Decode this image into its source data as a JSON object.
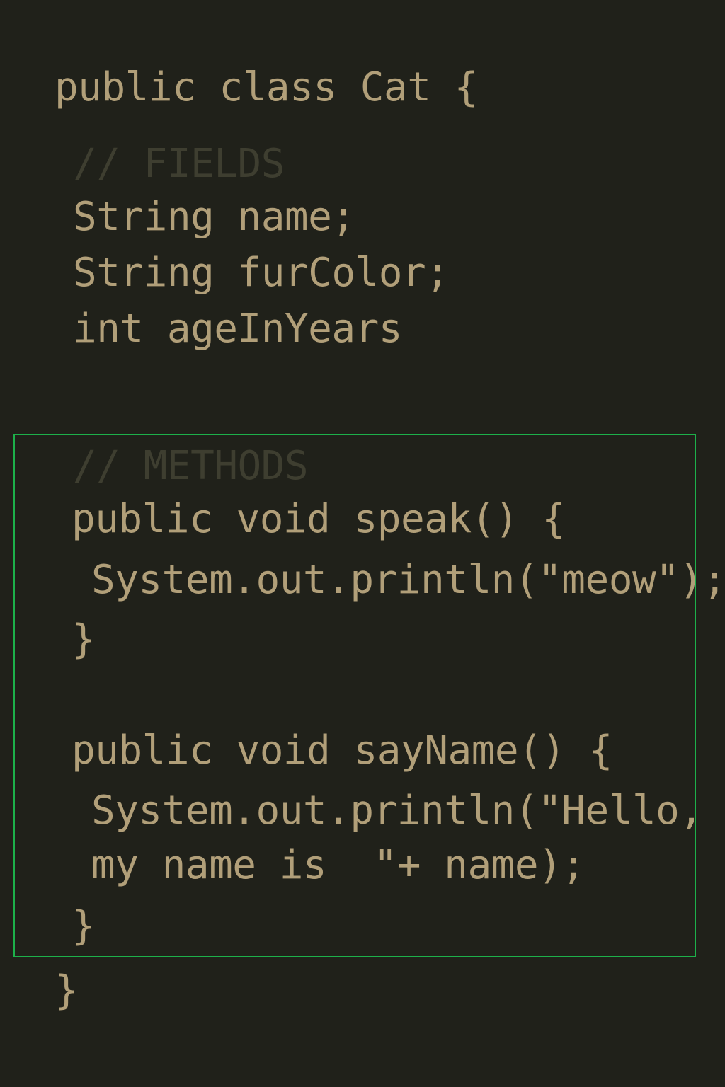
{
  "code": {
    "class_decl": "public class Cat {",
    "fields_comment": "// FIELDS",
    "field_name": "String name;",
    "field_fur": "String furColor;",
    "field_age": "int ageInYears",
    "methods_comment": "// METHODS",
    "speak_decl": "public void speak() {",
    "speak_body": "System.out.println(\"meow\");",
    "speak_close": "}",
    "sayname_decl": "public void sayName() {",
    "sayname_body_1": "System.out.println(\"Hello,",
    "sayname_body_2": "my name is  \"+ name);",
    "sayname_close": "}",
    "class_close": "}"
  },
  "colors": {
    "background": "#20211a",
    "code_text": "#b19f79",
    "comment_text": "#3e3e30",
    "highlight_border": "#1db04a"
  }
}
